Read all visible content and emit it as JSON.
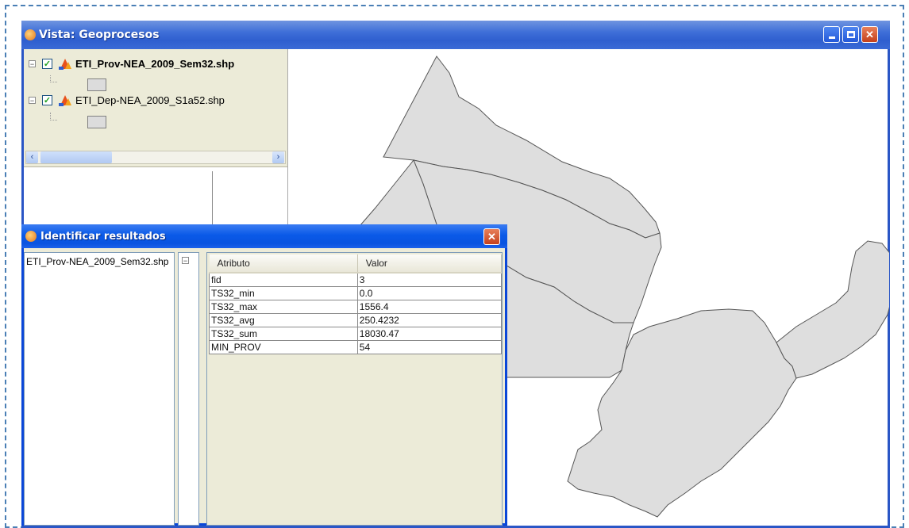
{
  "window": {
    "title": "Vista: Geoprocesos"
  },
  "toc": {
    "layers": [
      {
        "name": "ETI_Prov-NEA_2009_Sem32.shp",
        "checked": true,
        "bold": true
      },
      {
        "name": "ETI_Dep-NEA_2009_S1a52.shp",
        "checked": true,
        "bold": false
      }
    ]
  },
  "dialog": {
    "title": "Identificar resultados",
    "layer_item": "ETI_Prov-NEA_2009_Sem32.shp",
    "table": {
      "headers": [
        "Atributo",
        "Valor"
      ],
      "rows": [
        [
          "fid",
          "3"
        ],
        [
          "TS32_min",
          "0.0"
        ],
        [
          "TS32_max",
          "1556.4"
        ],
        [
          "TS32_avg",
          "250.4232"
        ],
        [
          "TS32_sum",
          "18030.47"
        ],
        [
          "MIN_PROV",
          "54"
        ]
      ]
    }
  },
  "colors": {
    "titlebar": "#3f6fd8",
    "dialog_titlebar": "#0a5ae8",
    "map_fill": "#dedede",
    "map_stroke": "#555555",
    "frame_dash": "#4a7fb5"
  }
}
